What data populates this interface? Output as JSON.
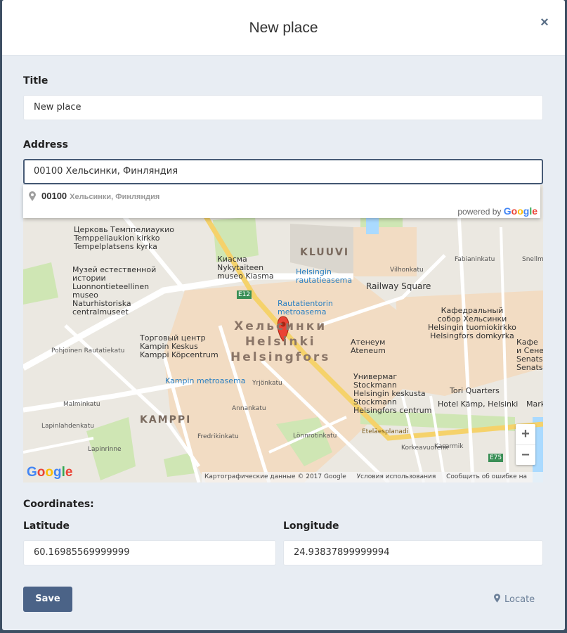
{
  "modal": {
    "title": "New place",
    "close_symbol": "×"
  },
  "form": {
    "title_label": "Title",
    "title_value": "New place",
    "address_label": "Address",
    "address_value": "00100 Хельсинки, Финляндия",
    "coordinates_label": "Coordinates:",
    "latitude_label": "Latitude",
    "latitude_value": "60.16985569999999",
    "longitude_label": "Longitude",
    "longitude_value": "24.93837899999994"
  },
  "autocomplete": {
    "main": "00100",
    "secondary": "Хельсинки, Финляндия",
    "powered_text": "powered by",
    "google": [
      "G",
      "o",
      "o",
      "g",
      "l",
      "e"
    ]
  },
  "map": {
    "labels": {
      "church": "Церковь Темппелиаукио\nTemppeliaukion kirkko\nTempelplatsens kyrka",
      "museum": "Музей естественной\nистории\nLuonnontieteellinen\nmuseo\nNaturhistoriska\ncentralmuseet",
      "kiasma": "Киасма\nNykytaiteen\nmuseo Kiasma",
      "kluuvi": "KLUUVI",
      "station1": "Helsingin\nrautatieasema",
      "railway": "Railway Square",
      "station2": "Rautatientorin\nmetroasema",
      "cathedral": "Кафедральный\nсобор Хельсинки\nHelsingin tuomiokirkko\nHelsingfors domkyrka",
      "city": "Хельсинки\nHelsinki\nHelsingfors",
      "ateneum": "Атенеум\nAteneum",
      "kamppi_center": "Торговый центр\nKampin Keskus\nKamppi Köpcentrum",
      "kamppi_metro": "Kampin metroasema",
      "stockmann": "Универмаг\nStockmann\nHelsingin keskusta\nStockmann\nHelsingfors centrum",
      "tori": "Tori Quarters",
      "kamp": "Hotel Kämp, Helsinki",
      "kamppi": "KAMPPI",
      "senate": "Кафе\nи Сене\nSenats\nSenats",
      "vilhon": "Vilhonkatu",
      "esplanadi": "Eteläesplanadi",
      "mannerheim": "Pohjoinen Rautatiekatu",
      "malmin": "Malminkatu",
      "lapinlahden": "Lapinlahdenkatu",
      "annankatu": "Annankatu",
      "fredrik": "Fredrikinkatu",
      "yrjon": "Yrjönkatu",
      "lonnrot": "Lönnrotinkatu",
      "korkea": "Korkeavuorenk",
      "kasarmi": "Kasarmik",
      "fabian": "Fabianinkatu",
      "snellman": "Snellmaninkatu",
      "lapinrinne": "Lapinrinne",
      "e12": "E12",
      "e75": "E75",
      "marker_end": "Mark"
    },
    "footer": {
      "data": "Картографические данные © 2017 Google",
      "terms": "Условия использования",
      "report": "Сообщить об ошибке на карте"
    },
    "zoom_in": "+",
    "zoom_out": "−"
  },
  "actions": {
    "save_label": "Save",
    "locate_label": "Locate"
  },
  "colors": {
    "accent": "#4b6387",
    "background": "#e8edf3",
    "marker": "#ea4335"
  }
}
